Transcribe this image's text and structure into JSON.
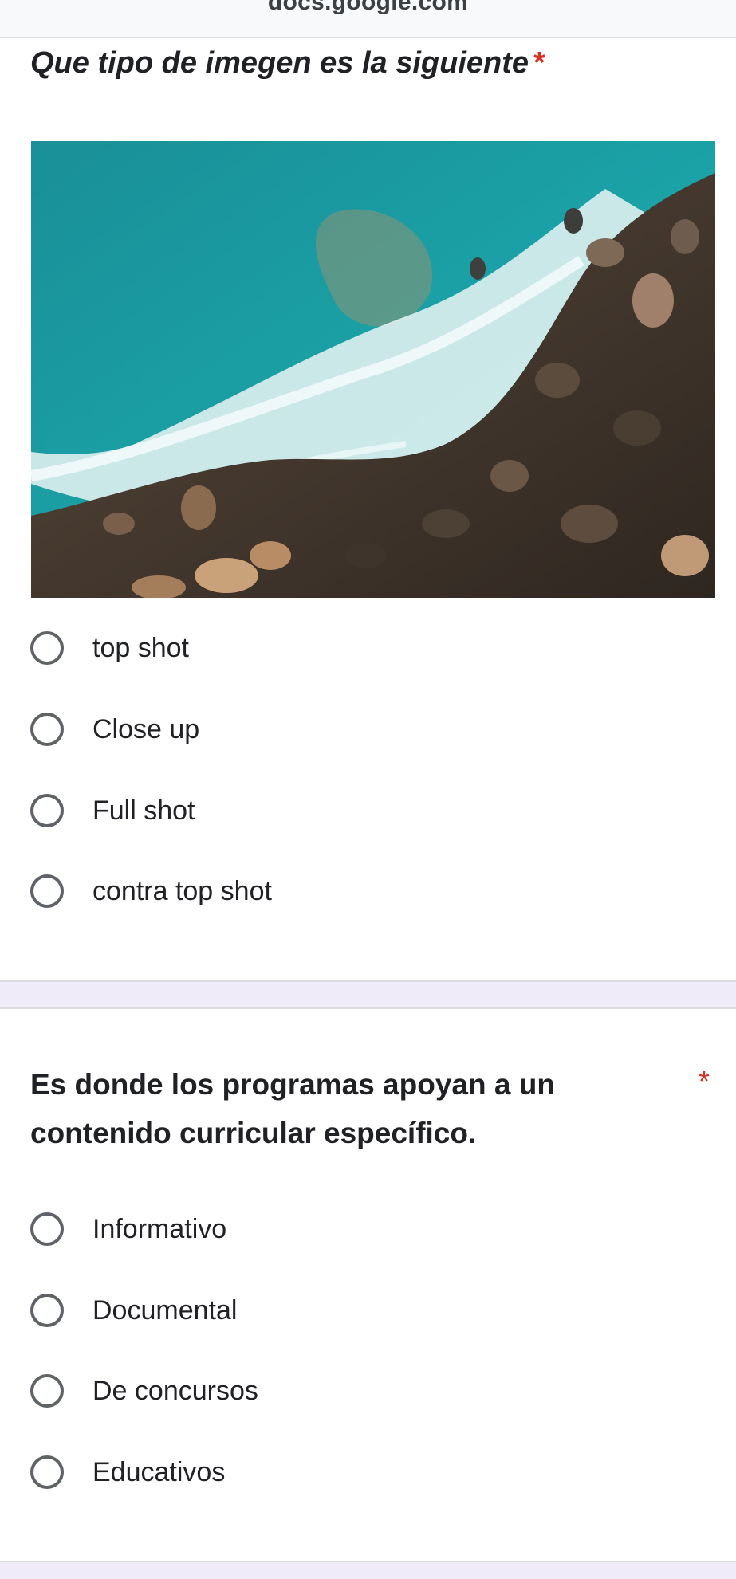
{
  "browser": {
    "url": "docs.google.com"
  },
  "question1": {
    "title": "Que tipo de imegen es la siguiente",
    "required_mark": "*",
    "options": [
      "top shot",
      "Close up",
      "Full shot",
      "contra top shot"
    ]
  },
  "question2": {
    "title": "Es donde los programas apoyan a un contenido curricular específico.",
    "required_mark": "*",
    "options": [
      "Informativo",
      "Documental",
      "De concursos",
      "Educativos"
    ]
  },
  "colors": {
    "required": "#d93025",
    "radio_border": "#5f6368",
    "section_band": "#f0ebf8"
  }
}
